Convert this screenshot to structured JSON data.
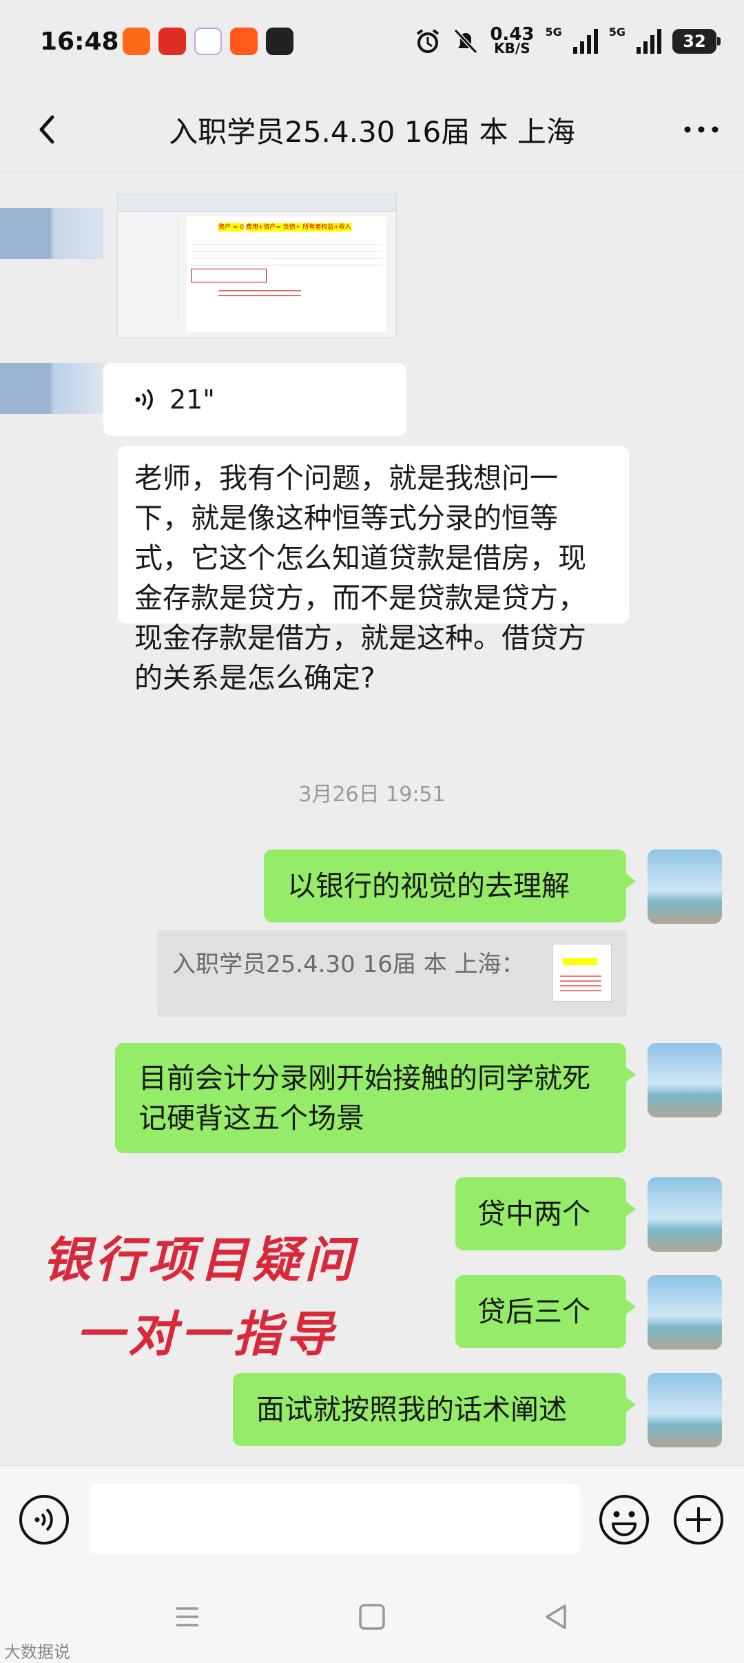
{
  "status_bar": {
    "time": "16:48",
    "speed_value": "0.43",
    "speed_unit": "KB/S",
    "network1": "5G",
    "network2": "5G",
    "battery": "32"
  },
  "header": {
    "title": "入职学员25.4.30 16届 本 上海"
  },
  "messages": {
    "voice_duration": "21\"",
    "question": "老师，我有个问题，就是我想问一下，就是像这种恒等式分录的恒等式，它这个怎么知道贷款是借房，现金存款是贷方，而不是贷款是贷方，现金存款是借方，就是这种。借贷方的关系是怎么确定?",
    "timestamp": "3月26日 19:51",
    "reply1": "以银行的视觉的去理解",
    "quote_label": "入职学员25.4.30 16届 本 上海：",
    "reply2": "目前会计分录刚开始接触的同学就死记硬背这五个场景",
    "reply3": "贷中两个",
    "reply4": "贷后三个",
    "reply5": "面试就按照我的话术阐述"
  },
  "overlay": {
    "line1": "银行项目疑问",
    "line2": "一对一指导"
  },
  "screenshot_thumb": {
    "eq_top": "资产 = 0",
    "eq_main": "费用+资产= 负债+ 所有者权益+收入"
  },
  "input": {
    "placeholder": ""
  },
  "watermark": "大数据说",
  "colors": {
    "background": "#ededed",
    "bubble_sent": "#95ec69",
    "bubble_received": "#ffffff",
    "overlay_red": "#d9283a"
  },
  "icons": [
    "back-arrow-icon",
    "more-dots-icon",
    "voice-icon",
    "emoji-icon",
    "plus-icon",
    "menu-icon",
    "home-icon",
    "back-triangle-icon"
  ]
}
